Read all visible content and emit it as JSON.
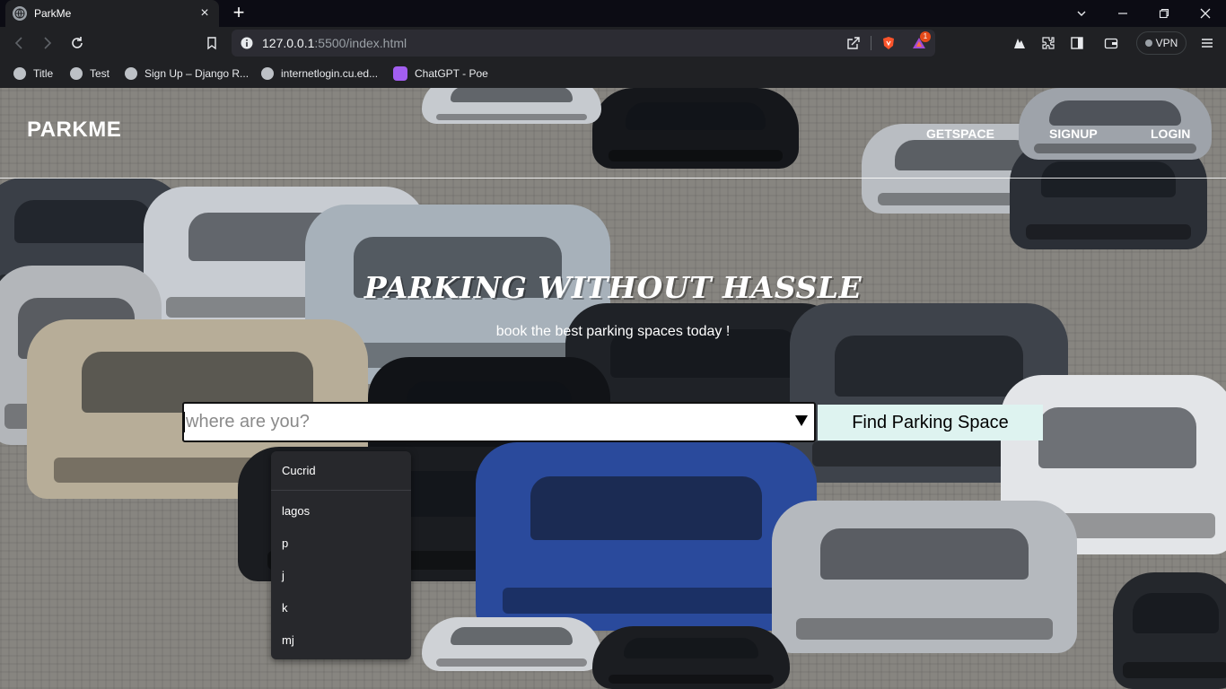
{
  "browser": {
    "tab_title": "ParkMe",
    "url_host": "127.0.0.1",
    "url_path": ":5500/index.html",
    "extension_badge_count": "1",
    "vpn_label": "VPN",
    "bookmarks": [
      {
        "label": "Title"
      },
      {
        "label": "Test"
      },
      {
        "label": "Sign Up – Django R..."
      },
      {
        "label": "internetlogin.cu.ed..."
      },
      {
        "label": "ChatGPT - Poe"
      }
    ]
  },
  "site": {
    "logo": "PARKME",
    "nav": [
      "GETSPACE",
      "SIGNUP",
      "LOGIN"
    ],
    "hero_title": "PARKING WITHOUT HASSLE",
    "hero_subtitle": "book the best parking spaces today !",
    "search_placeholder": "where are you?",
    "find_button": "Find Parking Space",
    "suggestions": [
      "Cucrid",
      "lagos",
      "p",
      "j",
      "k",
      "mj"
    ]
  },
  "colors": {
    "find_button_bg": "#def3f0",
    "chrome_bg": "#202124",
    "titlebar_bg": "#0c0c14",
    "dropdown_bg": "#27282c"
  }
}
